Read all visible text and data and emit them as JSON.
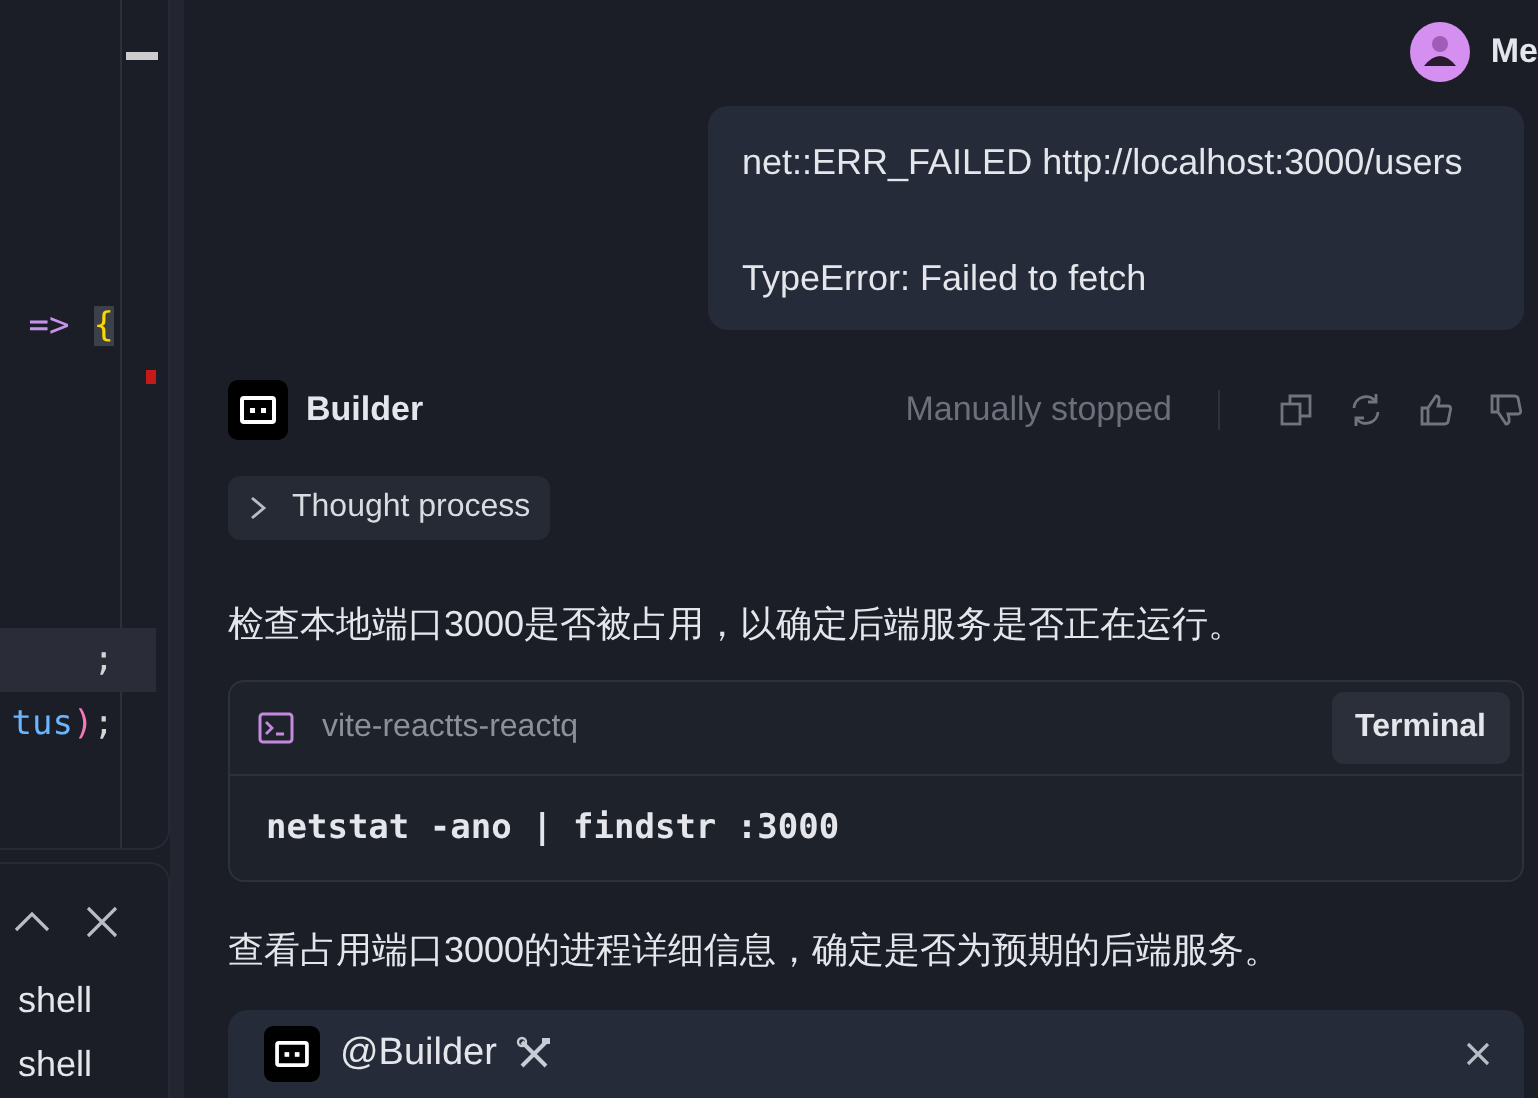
{
  "editor": {
    "lines": [
      {
        "highlighted": false,
        "tokens": [
          {
            "text": "=>",
            "kind": "operator"
          },
          {
            "text": "{",
            "kind": "brace"
          }
        ]
      },
      {
        "highlighted": true,
        "tokens": [
          {
            "text": ";",
            "kind": "punct"
          }
        ]
      },
      {
        "highlighted": false,
        "tokens": [
          {
            "text": "tus",
            "kind": "property"
          },
          {
            "text": ")",
            "kind": "paren"
          },
          {
            "text": ";",
            "kind": "punct"
          }
        ]
      }
    ]
  },
  "terminal_panel": {
    "items": [
      "shell",
      "shell"
    ]
  },
  "chat": {
    "user": {
      "name": "Me",
      "message_lines": [
        "net::ERR_FAILED http://localhost:3000/users",
        "TypeError: Failed to fetch"
      ]
    },
    "assistant": {
      "name": "Builder",
      "status": "Manually stopped",
      "thought": {
        "label": "Thought process",
        "expanded": false
      },
      "paragraph_1": "检查本地端口3000是否被占用，以确定后端服务是否正在运行。",
      "terminal": {
        "project": "vite-reactts-reactq",
        "button": "Terminal",
        "command": "netstat -ano | findstr :3000"
      },
      "paragraph_2": "查看占用端口3000的进程详细信息，确定是否为预期的后端服务。"
    },
    "composer": {
      "mention": "@Builder"
    }
  }
}
